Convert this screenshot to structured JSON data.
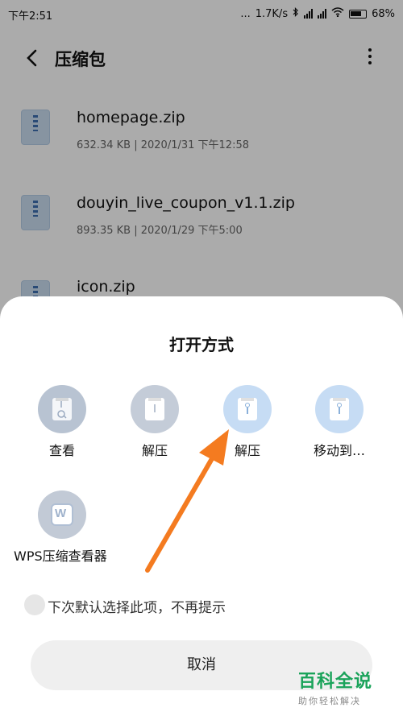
{
  "status_bar": {
    "time": "下午2:51",
    "dots": "...",
    "speed": "1.7K/s",
    "battery": "68%"
  },
  "header": {
    "title": "压缩包"
  },
  "files": [
    {
      "name": "homepage.zip",
      "size": "632.34 KB",
      "date": "2020/1/31 下午12:58"
    },
    {
      "name": "douyin_live_coupon_v1.1.zip",
      "size": "893.35 KB",
      "date": "2020/1/29 下午5:00"
    },
    {
      "name": "icon.zip",
      "size": "",
      "date": ""
    }
  ],
  "dialog": {
    "title": "打开方式",
    "options": [
      {
        "label": "查看",
        "icon": "view-icon"
      },
      {
        "label": "解压",
        "icon": "archive-icon"
      },
      {
        "label": "解压",
        "icon": "archive-icon"
      },
      {
        "label": "移动到…",
        "icon": "archive-icon"
      },
      {
        "label": "WPS压缩查看器",
        "icon": "wps-icon"
      }
    ],
    "remember": "下次默认选择此项，不再提示",
    "cancel": "取消"
  },
  "colors": {
    "annotation_arrow": "#f47b20",
    "watermark_green": "#1aa35a"
  },
  "watermark": {
    "brand": "百科全说",
    "tagline": "助你轻松解决"
  }
}
